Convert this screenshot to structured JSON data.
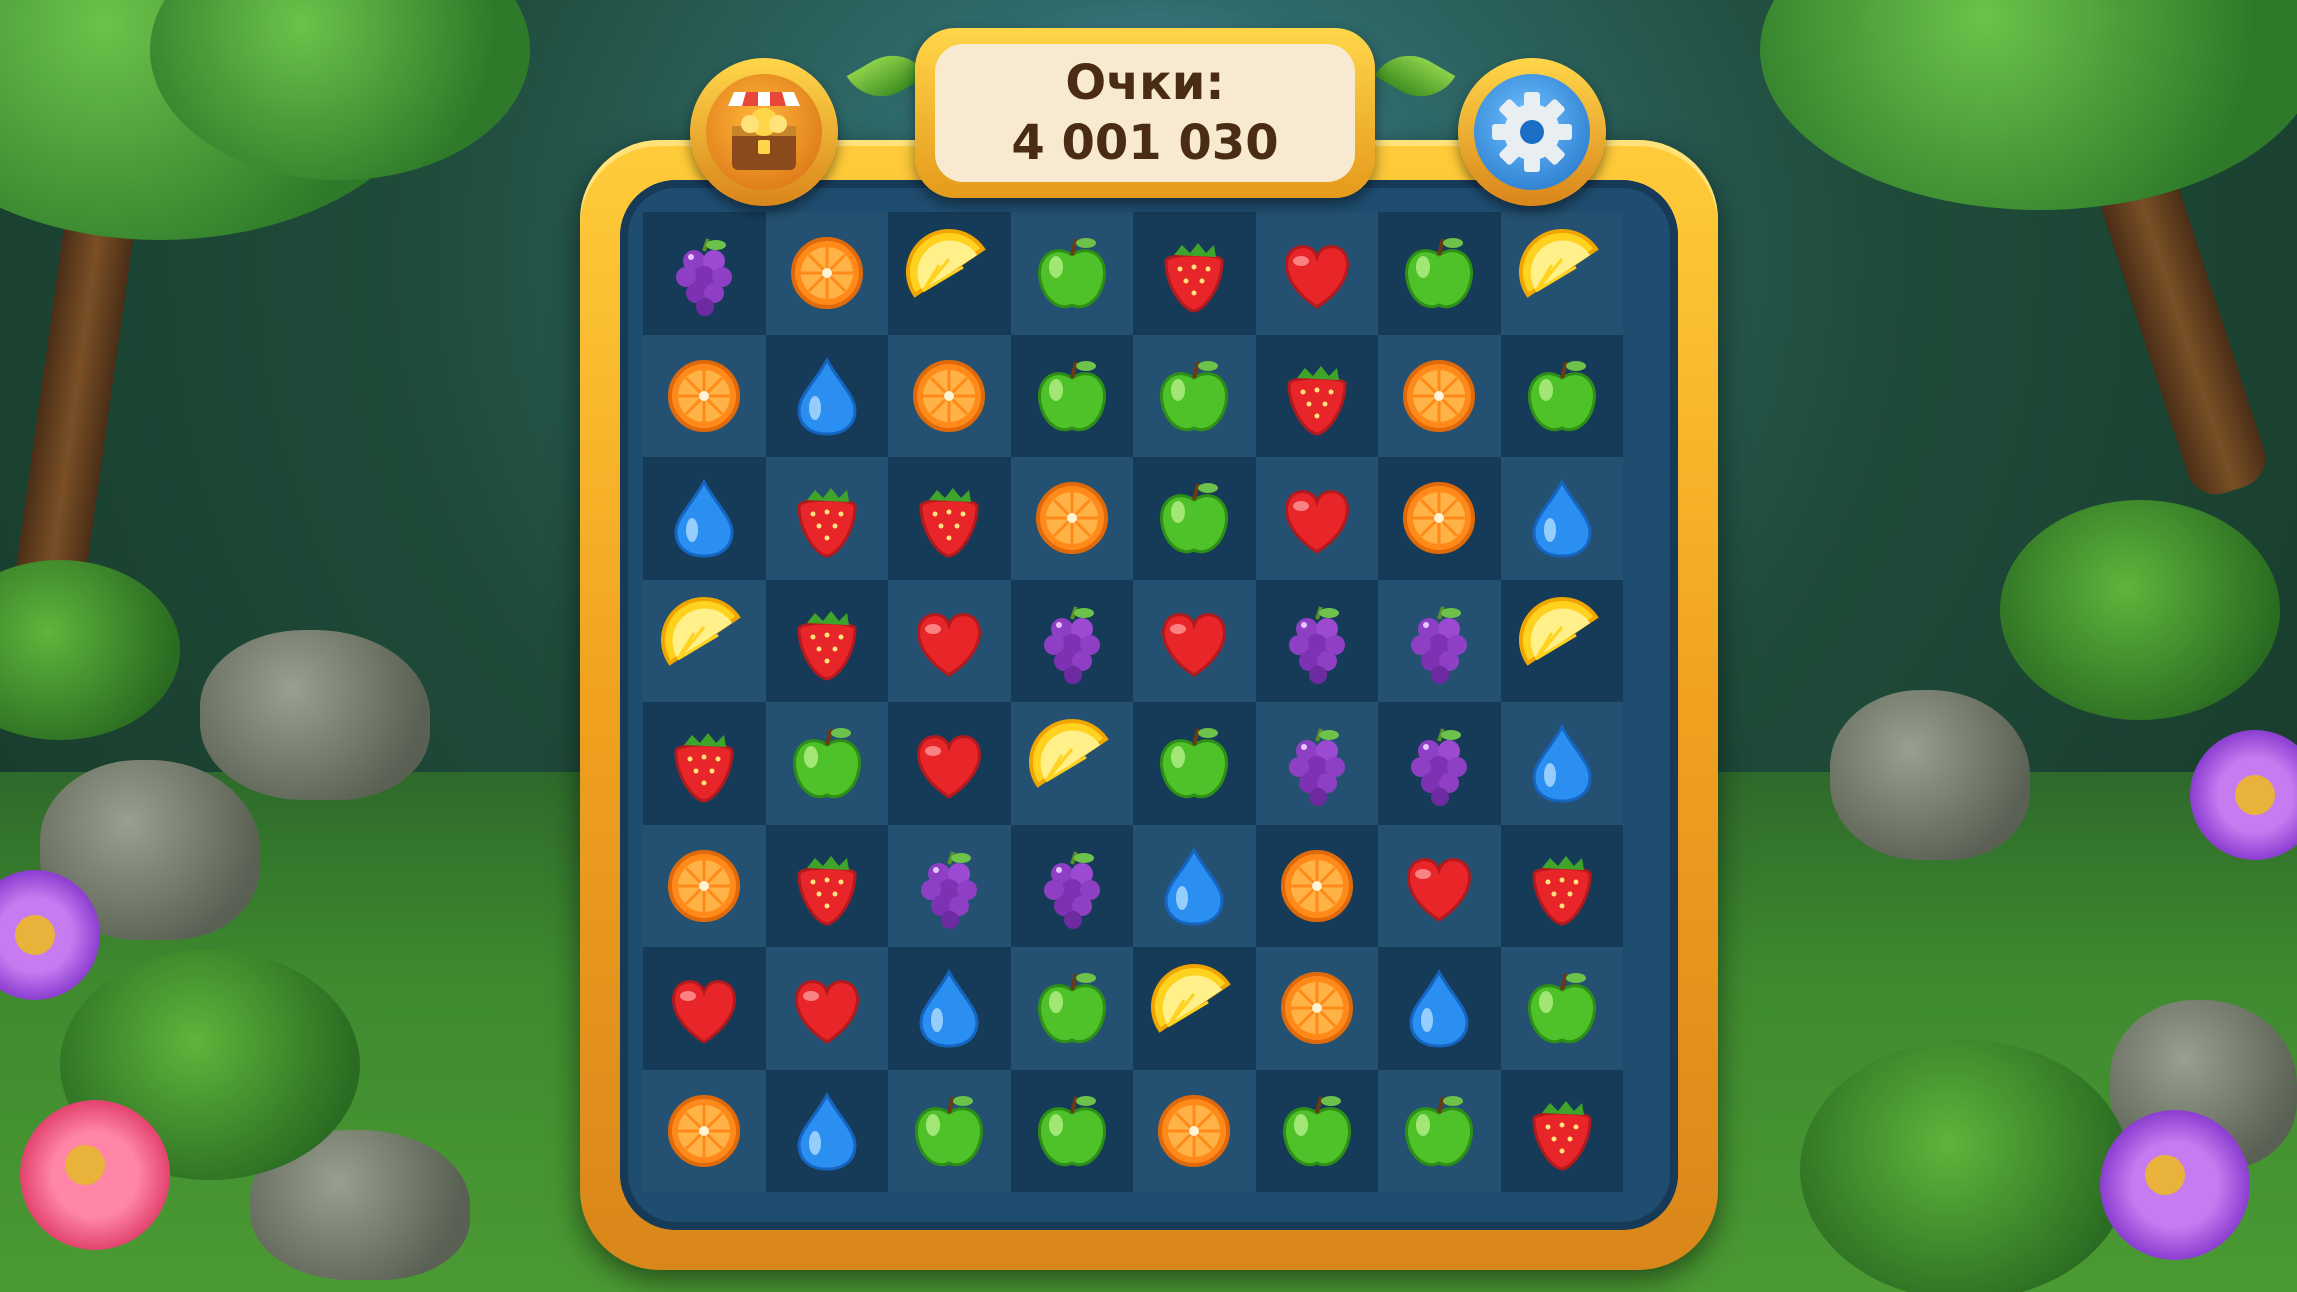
{
  "score": {
    "label": "Очки:",
    "value": "4 001 030"
  },
  "buttons": {
    "shop_icon": "treasure-chest-shop-icon",
    "settings_icon": "gear-icon"
  },
  "board": {
    "rows": 8,
    "cols": 8,
    "cells": [
      [
        "grape",
        "orange",
        "lemon",
        "apple",
        "strawberry",
        "heart",
        "apple",
        "lemon"
      ],
      [
        "orange",
        "drop",
        "orange",
        "apple",
        "apple",
        "strawberry",
        "orange",
        "apple"
      ],
      [
        "drop",
        "strawberry",
        "strawberry",
        "orange",
        "apple",
        "heart",
        "orange",
        "drop"
      ],
      [
        "lemon",
        "strawberry",
        "heart",
        "grape",
        "heart",
        "grape",
        "grape",
        "lemon"
      ],
      [
        "strawberry",
        "apple",
        "heart",
        "lemon",
        "apple",
        "grape",
        "grape",
        "drop"
      ],
      [
        "orange",
        "strawberry",
        "grape",
        "grape",
        "drop",
        "orange",
        "heart",
        "strawberry"
      ],
      [
        "heart",
        "heart",
        "drop",
        "apple",
        "lemon",
        "orange",
        "drop",
        "apple"
      ],
      [
        "orange",
        "drop",
        "apple",
        "apple",
        "orange",
        "apple",
        "apple",
        "strawberry"
      ]
    ]
  },
  "colors": {
    "frame_gold": "#f0a11f",
    "board_blue": "#1f4d70",
    "score_text": "#4a2c14"
  }
}
